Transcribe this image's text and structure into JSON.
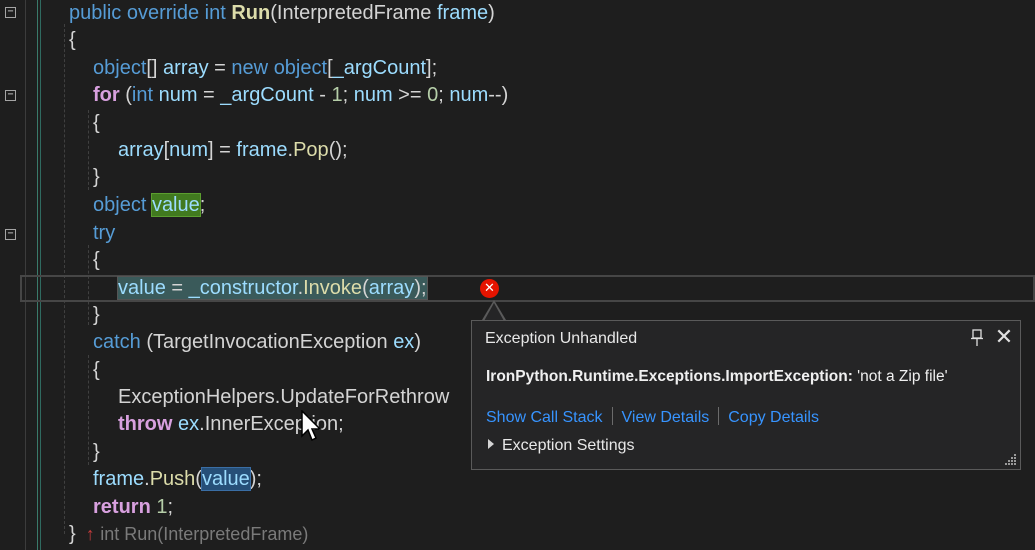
{
  "editor": {
    "lines": {
      "l1": {
        "kw1": "public",
        "kw2": "override",
        "kw3": "int",
        "fn": "Run",
        "p1": "(",
        "ty": "InterpretedFrame",
        "sp": " ",
        "var": "frame",
        "p2": ")"
      },
      "l2": {
        "t": "{"
      },
      "l3": {
        "kw": "object",
        "p1": "[] ",
        "var": "array",
        "p2": " = ",
        "kw2": "new",
        "sp": " ",
        "kw3": "object",
        "p3": "[",
        "var2": "_argCount",
        "p4": "];"
      },
      "l4": {
        "kw": "for",
        "p1": " (",
        "kw2": "int",
        "sp": " ",
        "var": "num",
        "p2": " = ",
        "var2": "_argCount",
        "p3": " - ",
        "num": "1",
        "p4": "; ",
        "var3": "num",
        "p5": " >= ",
        "num2": "0",
        "p6": "; ",
        "var4": "num",
        "p7": "--)"
      },
      "l5": {
        "t": "{"
      },
      "l6": {
        "var": "array",
        "p1": "[",
        "var2": "num",
        "p2": "] = ",
        "var3": "frame",
        "p3": ".",
        "fn": "Pop",
        "p4": "();"
      },
      "l7": {
        "t": "}"
      },
      "l8": {
        "kw": "object",
        "sp": " ",
        "var": "value",
        "p1": ";"
      },
      "l9": {
        "kw": "try"
      },
      "l10": {
        "t": "{"
      },
      "l11": {
        "var": "value",
        "p1": " = ",
        "var2": "_constructor",
        "p2": ".",
        "fn": "Invoke",
        "p3": "(",
        "var3": "array",
        "p4": ");"
      },
      "l12": {
        "t": "}"
      },
      "l13": {
        "kw": "catch",
        "p1": " (",
        "ty": "TargetInvocationException",
        "sp": " ",
        "var": "ex",
        "p2": ")"
      },
      "l14": {
        "t": "{"
      },
      "l15": {
        "ty": "ExceptionHelpers",
        "p1": ".",
        "fn": "UpdateForRethrow"
      },
      "l16": {
        "kw": "throw",
        "sp": " ",
        "var": "ex",
        "p1": ".",
        "var2": "InnerException",
        "p2": ";"
      },
      "l17": {
        "t": "}"
      },
      "l18": {
        "var": "frame",
        "p1": ".",
        "fn": "Push",
        "p2": "(",
        "var2": "value",
        "p3": ");"
      },
      "l19": {
        "kw": "return",
        "sp": " ",
        "num": "1",
        "p1": ";"
      },
      "l20": {
        "t": "}",
        "arrow": "↑",
        "peek": "int Run(InterpretedFrame)"
      }
    }
  },
  "popup": {
    "title": "Exception Unhandled",
    "exception_type": "IronPython.Runtime.Exceptions.ImportException:",
    "exception_message": " 'not a Zip file'",
    "links": {
      "call_stack": "Show Call Stack",
      "view_details": "View Details",
      "copy_details": "Copy Details"
    },
    "settings": "Exception Settings",
    "close_glyph": "✕"
  },
  "colors": {
    "error": "#e51400",
    "link": "#3794ff",
    "keyword": "#569cd6",
    "control": "#d8a0df",
    "function": "#dcdcaa",
    "type": "#4ec9b0",
    "variable": "#9cdcfe",
    "number": "#b5cea8"
  }
}
